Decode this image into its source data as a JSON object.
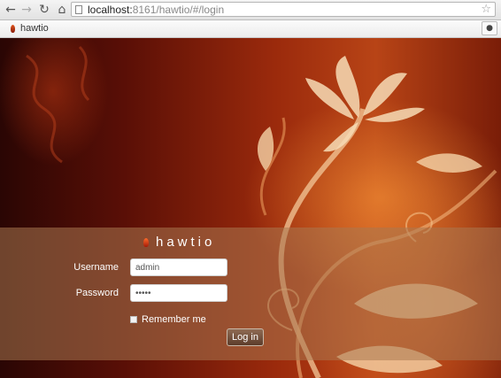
{
  "browser": {
    "url_host": "localhost:",
    "url_rest": "8161/hawtio/#/login"
  },
  "app_bar": {
    "brand": "hawtio"
  },
  "login": {
    "title": "hawtio",
    "username_label": "Username",
    "username_value": "admin",
    "password_label": "Password",
    "password_value": "admin",
    "remember_label": "Remember me",
    "remember_checked": false,
    "button_label": "Log in"
  },
  "colors": {
    "brand": "#c0391b",
    "panel": "#aa7850"
  }
}
